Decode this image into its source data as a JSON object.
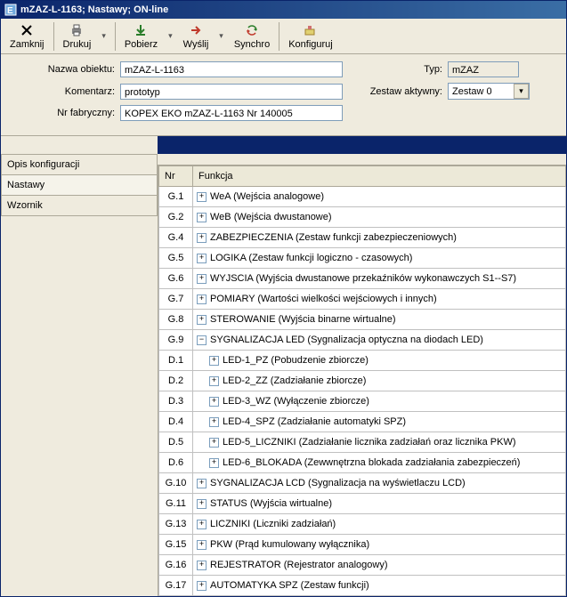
{
  "title": "mZAZ-L-1163; Nastawy; ON-line",
  "toolbar": {
    "close": "Zamknij",
    "print": "Drukuj",
    "download": "Pobierz",
    "send": "Wyślij",
    "sync": "Synchro",
    "config": "Konfiguruj"
  },
  "form": {
    "labels": {
      "object_name": "Nazwa obiektu:",
      "comment": "Komentarz:",
      "serial": "Nr fabryczny:",
      "type": "Typ:",
      "active_set": "Zestaw aktywny:"
    },
    "object_name": "mZAZ-L-1163",
    "comment": "prototyp",
    "serial": "KOPEX EKO  mZAZ-L-1163 Nr 140005",
    "type": "mZAZ",
    "active_set": "Zestaw 0"
  },
  "side_tabs": {
    "config_desc": "Opis konfiguracji",
    "settings": "Nastawy",
    "template": "Wzornik"
  },
  "grid": {
    "headers": {
      "nr": "Nr",
      "fn": "Funkcja"
    },
    "rows": [
      {
        "nr": "G.1",
        "depth": 0,
        "exp": "+",
        "label": "WeA (Wejścia analogowe)"
      },
      {
        "nr": "G.2",
        "depth": 0,
        "exp": "+",
        "label": "WeB (Wejścia dwustanowe)"
      },
      {
        "nr": "G.4",
        "depth": 0,
        "exp": "+",
        "label": "ZABEZPIECZENIA (Zestaw funkcji zabezpieczeniowych)"
      },
      {
        "nr": "G.5",
        "depth": 0,
        "exp": "+",
        "label": "LOGIKA (Zestaw funkcji logiczno - czasowych)"
      },
      {
        "nr": "G.6",
        "depth": 0,
        "exp": "+",
        "label": "WYJSCIA (Wyjścia dwustanowe przekaźników wykonawczych S1--S7)"
      },
      {
        "nr": "G.7",
        "depth": 0,
        "exp": "+",
        "label": "POMIARY (Wartości wielkości wejściowych i innych)"
      },
      {
        "nr": "G.8",
        "depth": 0,
        "exp": "+",
        "label": "STEROWANIE (Wyjścia binarne wirtualne)"
      },
      {
        "nr": "G.9",
        "depth": 0,
        "exp": "−",
        "label": "SYGNALIZACJA LED (Sygnalizacja optyczna na diodach LED)"
      },
      {
        "nr": "D.1",
        "depth": 1,
        "exp": "+",
        "label": "LED-1_PZ (Pobudzenie zbiorcze)"
      },
      {
        "nr": "D.2",
        "depth": 1,
        "exp": "+",
        "label": "LED-2_ZZ (Zadziałanie zbiorcze)"
      },
      {
        "nr": "D.3",
        "depth": 1,
        "exp": "+",
        "label": "LED-3_WZ (Wyłączenie zbiorcze)"
      },
      {
        "nr": "D.4",
        "depth": 1,
        "exp": "+",
        "label": "LED-4_SPZ (Zadziałanie automatyki SPZ)"
      },
      {
        "nr": "D.5",
        "depth": 1,
        "exp": "+",
        "label": "LED-5_LICZNIKI (Zadziałanie licznika zadziałań oraz licznika PKW)"
      },
      {
        "nr": "D.6",
        "depth": 1,
        "exp": "+",
        "label": "LED-6_BLOKADA (Zewwnętrzna blokada zadziałania zabezpieczeń)"
      },
      {
        "nr": "G.10",
        "depth": 0,
        "exp": "+",
        "label": "SYGNALIZACJA LCD (Sygnalizacja  na wyświetlaczu LCD)"
      },
      {
        "nr": "G.11",
        "depth": 0,
        "exp": "+",
        "label": "STATUS (Wyjścia wirtualne)"
      },
      {
        "nr": "G.13",
        "depth": 0,
        "exp": "+",
        "label": "LICZNIKI (Liczniki zadziałań)"
      },
      {
        "nr": "G.15",
        "depth": 0,
        "exp": "+",
        "label": "PKW (Prąd kumulowany wyłącznika)"
      },
      {
        "nr": "G.16",
        "depth": 0,
        "exp": "+",
        "label": "REJESTRATOR (Rejestrator analogowy)"
      },
      {
        "nr": "G.17",
        "depth": 0,
        "exp": "+",
        "label": "AUTOMATYKA SPZ (Zestaw funkcji)"
      }
    ]
  }
}
